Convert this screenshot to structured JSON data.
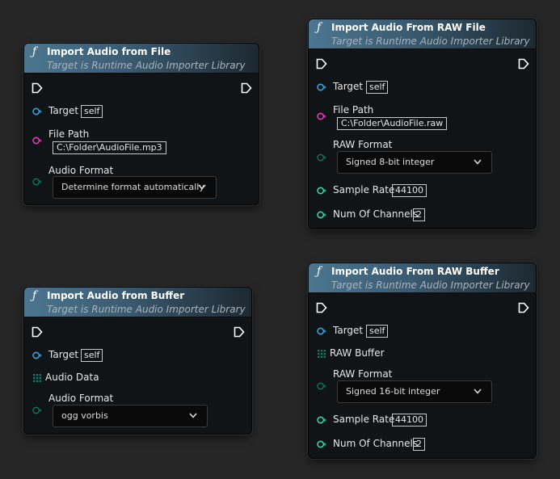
{
  "nodes": {
    "import_file": {
      "icon": "function-icon",
      "title": "Import Audio from File",
      "subtitle": "Target is Runtime Audio Importer Library",
      "target_label": "Target",
      "target_value": "self",
      "file_path_label": "File Path",
      "file_path_value": "C:\\Folder\\AudioFile.mp3",
      "audio_format_label": "Audio Format",
      "audio_format_value": "Determine format automatically"
    },
    "import_raw_file": {
      "icon": "function-icon",
      "title": "Import Audio From RAW File",
      "subtitle": "Target is Runtime Audio Importer Library",
      "target_label": "Target",
      "target_value": "self",
      "file_path_label": "File Path",
      "file_path_value": "C:\\Folder\\AudioFile.raw",
      "raw_format_label": "RAW Format",
      "raw_format_value": "Signed 8-bit integer",
      "sample_rate_label": "Sample Rate",
      "sample_rate_value": "44100",
      "channels_label": "Num Of Channels",
      "channels_value": "2"
    },
    "import_buffer": {
      "icon": "function-icon",
      "title": "Import Audio from Buffer",
      "subtitle": "Target is Runtime Audio Importer Library",
      "target_label": "Target",
      "target_value": "self",
      "audio_data_label": "Audio Data",
      "audio_format_label": "Audio Format",
      "audio_format_value": "ogg vorbis"
    },
    "import_raw_buffer": {
      "icon": "function-icon",
      "title": "Import Audio From RAW Buffer",
      "subtitle": "Target is Runtime Audio Importer Library",
      "target_label": "Target",
      "target_value": "self",
      "raw_buffer_label": "RAW Buffer",
      "raw_format_label": "RAW Format",
      "raw_format_value": "Signed 16-bit integer",
      "sample_rate_label": "Sample Rate",
      "sample_rate_value": "44100",
      "channels_label": "Num Of Channels",
      "channels_value": "2"
    }
  },
  "colors": {
    "graph_background": "#262626",
    "node_body": "#111416",
    "header_blue": "#4c7690",
    "object_pin": "#35a7e0",
    "string_pin": "#e43ac0",
    "enum_pin": "#0e7766",
    "int_pin": "#33d9a5",
    "array_pin": "#0e7766",
    "exec_pin": "#ffffff"
  }
}
